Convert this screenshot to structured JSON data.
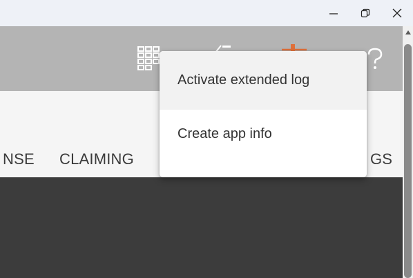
{
  "window": {
    "minimize_icon": "minimize-icon",
    "restore_icon": "restore-icon",
    "close_icon": "close-icon"
  },
  "appbar": {
    "icons": [
      "grid-icon",
      "share-icon",
      "settings-slider-icon",
      "help-icon"
    ],
    "accent": "#e0703a"
  },
  "tabs": [
    "NSE",
    "CLAIMING",
    "GS"
  ],
  "menu": {
    "items": [
      "Activate extended log",
      "Create app info"
    ]
  },
  "colors": {
    "appbar": "#b4b4b4",
    "subbar": "#f5f5f5",
    "content": "#3c3c3c"
  }
}
